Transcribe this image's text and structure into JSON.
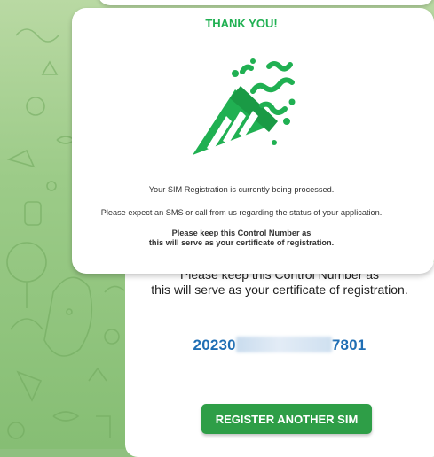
{
  "modal": {
    "title": "THANK YOU!",
    "icon": "party-popper-icon",
    "processing_text": "Your SIM Registration is currently being processed.",
    "expect_text": "Please expect an SMS or call from us regarding the status of your application.",
    "keep_line1": "Please keep this Control Number as",
    "keep_line2": "this will serve as your certificate of registration."
  },
  "card": {
    "keep_line1": "Please keep this Control Number as",
    "keep_line2": "this will serve as your certificate of registration.",
    "control_prefix": "20230",
    "control_suffix": "7801",
    "register_button_label": "REGISTER ANOTHER SIM"
  },
  "colors": {
    "accent_green": "#20b052",
    "button_green": "#2e9e47",
    "control_blue": "#1f6eb4",
    "background_green": "#9ccb88"
  }
}
